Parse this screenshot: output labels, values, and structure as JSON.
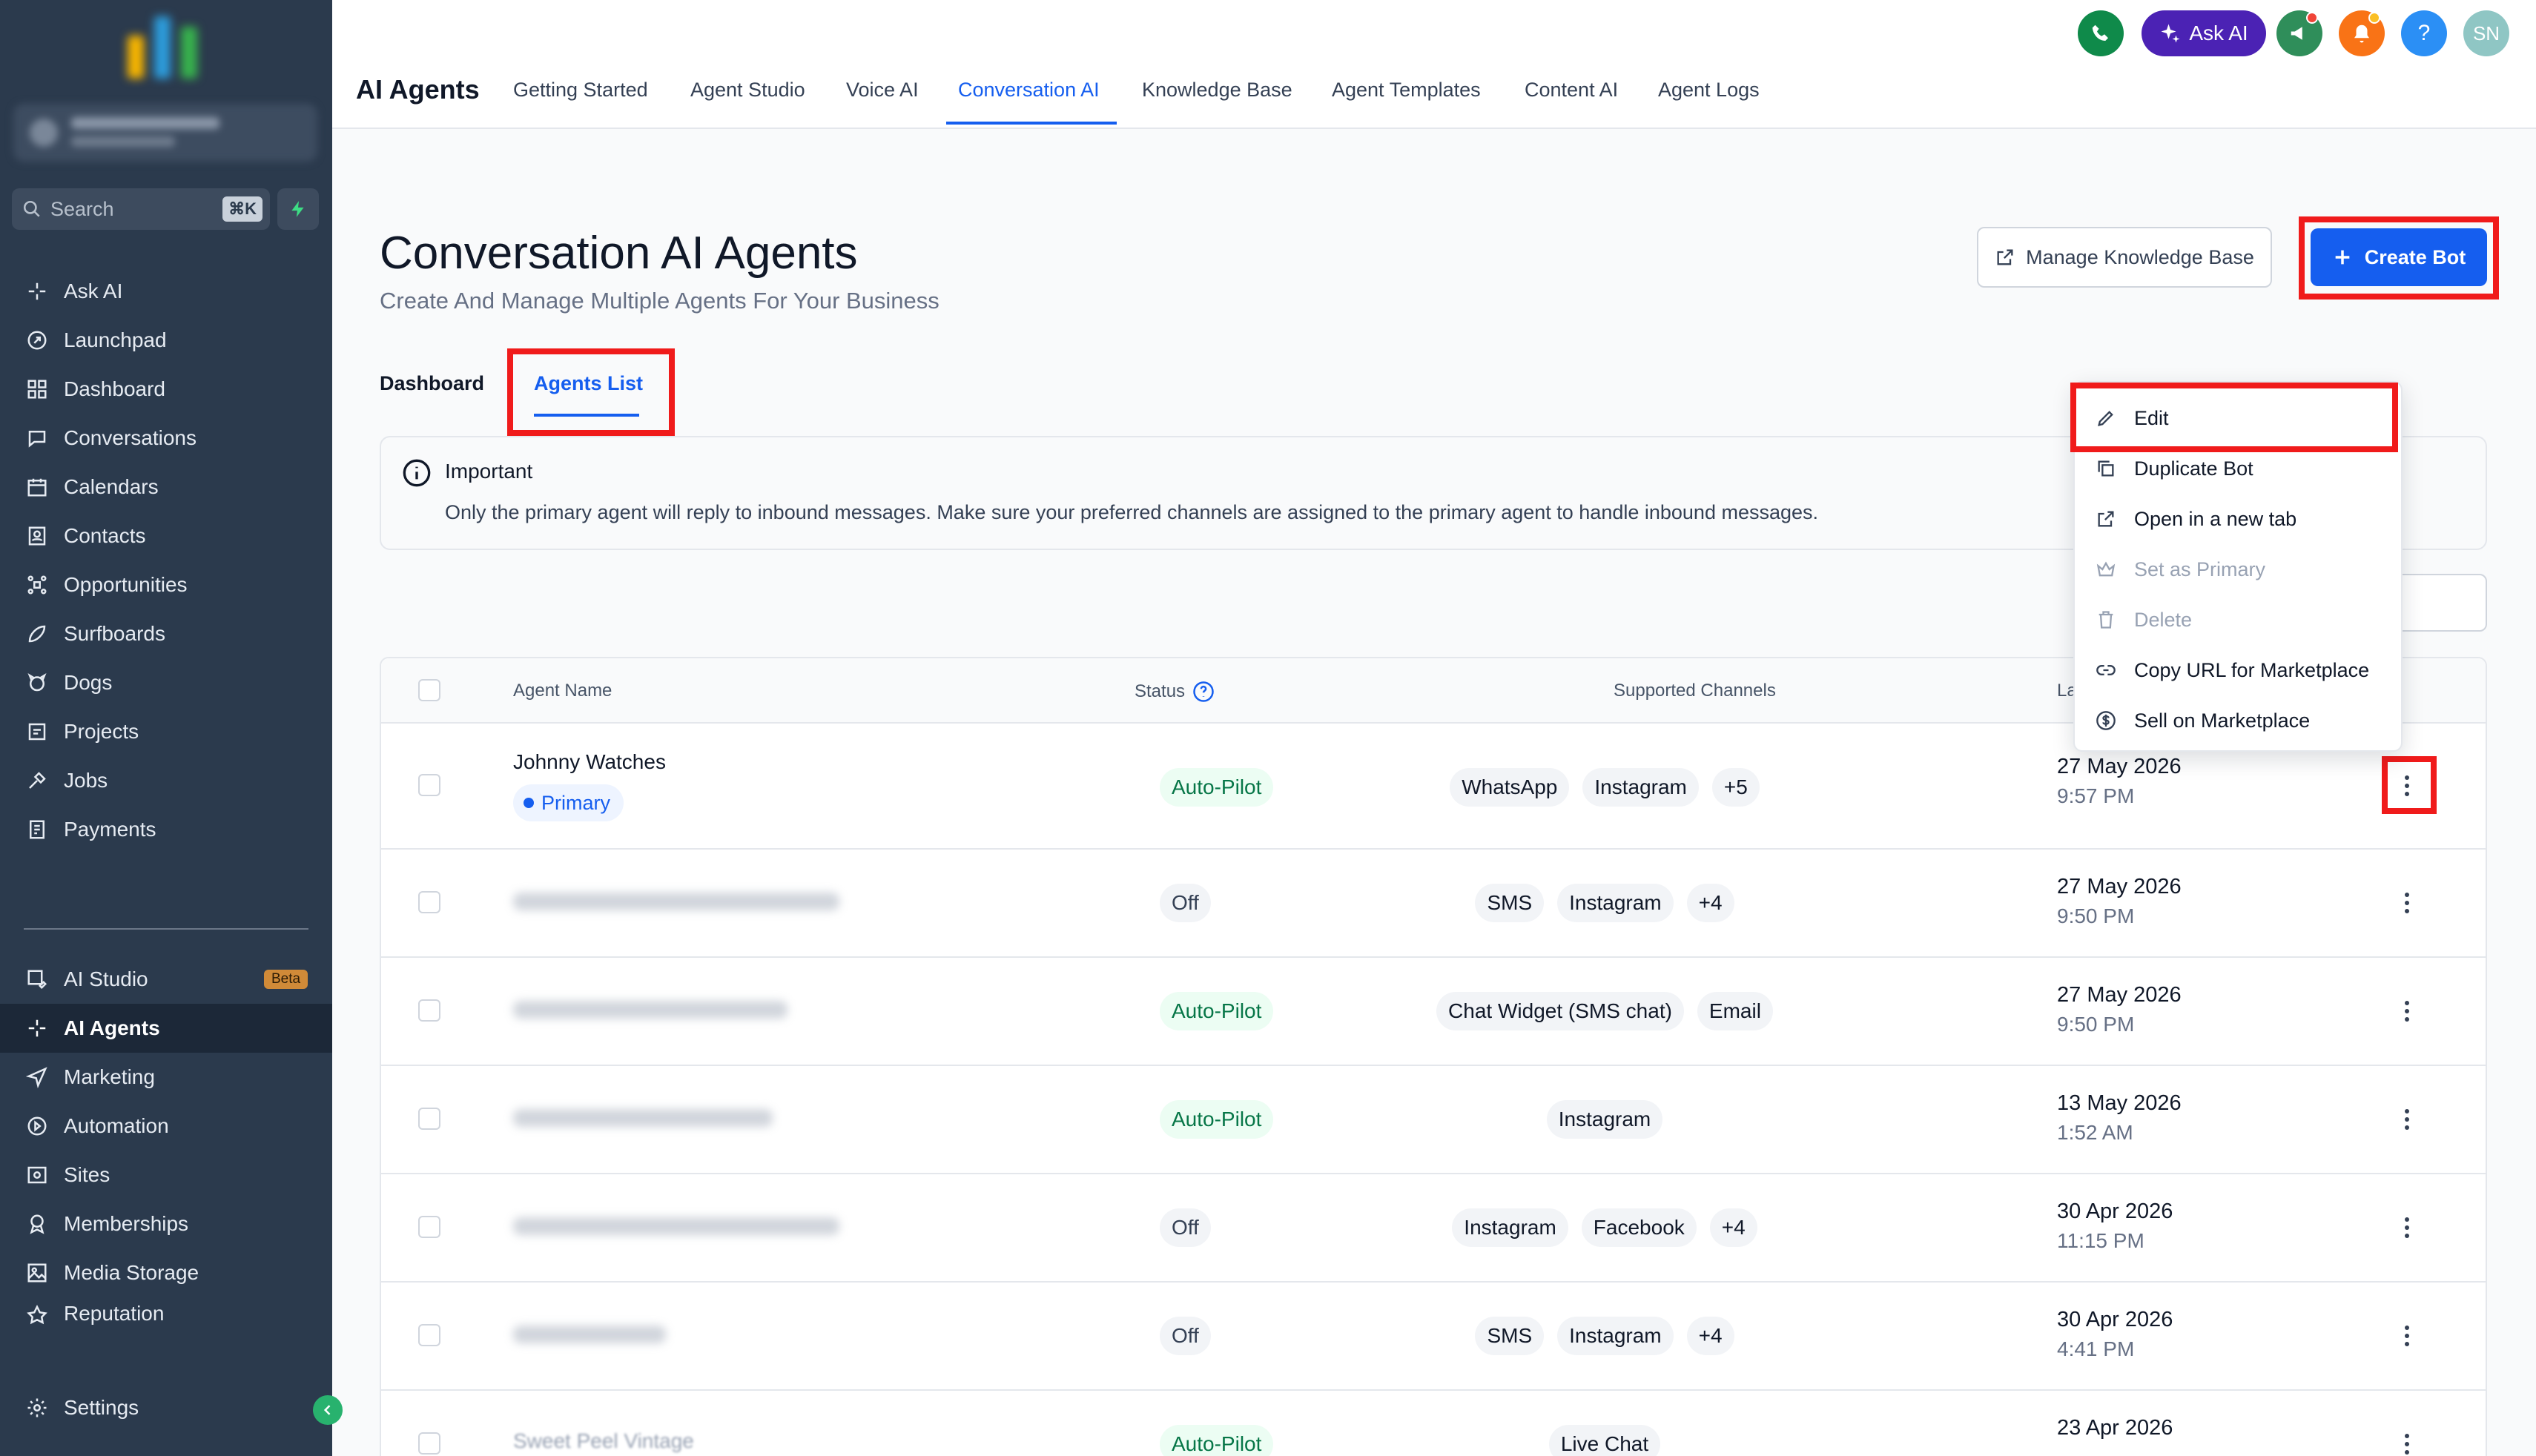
{
  "sidebar": {
    "search_placeholder": "Search",
    "search_shortcut": "⌘K",
    "items": [
      {
        "label": "Ask AI",
        "icon": "sparkle-icon"
      },
      {
        "label": "Launchpad",
        "icon": "rocket-icon"
      },
      {
        "label": "Dashboard",
        "icon": "grid-icon"
      },
      {
        "label": "Conversations",
        "icon": "chat-icon"
      },
      {
        "label": "Calendars",
        "icon": "calendar-icon"
      },
      {
        "label": "Contacts",
        "icon": "contacts-icon"
      },
      {
        "label": "Opportunities",
        "icon": "opportunities-icon"
      },
      {
        "label": "Surfboards",
        "icon": "surfboard-icon"
      },
      {
        "label": "Dogs",
        "icon": "dog-icon"
      },
      {
        "label": "Projects",
        "icon": "projects-icon"
      },
      {
        "label": "Jobs",
        "icon": "jobs-icon"
      },
      {
        "label": "Payments",
        "icon": "payments-icon"
      }
    ],
    "items2": [
      {
        "label": "AI Studio",
        "icon": "ai-studio-icon",
        "badge": "Beta"
      },
      {
        "label": "AI Agents",
        "icon": "sparkle-icon",
        "active": true
      },
      {
        "label": "Marketing",
        "icon": "send-icon"
      },
      {
        "label": "Automation",
        "icon": "automation-icon"
      },
      {
        "label": "Sites",
        "icon": "sites-icon"
      },
      {
        "label": "Memberships",
        "icon": "membership-icon"
      },
      {
        "label": "Media Storage",
        "icon": "media-icon"
      },
      {
        "label": "Reputation",
        "icon": "reputation-icon"
      }
    ],
    "settings_label": "Settings"
  },
  "topbar": {
    "title": "AI Agents",
    "tabs": [
      "Getting Started",
      "Agent Studio",
      "Voice AI",
      "Conversation AI",
      "Knowledge Base",
      "Agent Templates",
      "Content AI",
      "Agent Logs"
    ],
    "active_tab": "Conversation AI",
    "ask_ai_label": "Ask AI",
    "avatar_initials": "SN"
  },
  "page": {
    "title": "Conversation AI Agents",
    "subtitle": "Create And Manage Multiple Agents For Your Business",
    "manage_kb_label": "Manage Knowledge Base",
    "create_bot_label": "Create Bot",
    "tabs": [
      "Dashboard",
      "Agents List"
    ],
    "notice_title": "Important",
    "notice_message": "Only the primary agent will reply to inbound messages. Make sure your preferred channels are assigned to the primary agent to handle inbound messages."
  },
  "table": {
    "headers": {
      "name": "Agent Name",
      "status": "Status",
      "channels": "Supported Channels",
      "last": "La"
    },
    "rows": [
      {
        "name": "Johnny Watches",
        "primary_label": "Primary",
        "status": "Auto-Pilot",
        "channels": [
          "WhatsApp",
          "Instagram",
          "+5"
        ],
        "date": "27 May 2026",
        "time": "9:57 PM"
      },
      {
        "name": "",
        "status": "Off",
        "channels": [
          "SMS",
          "Instagram",
          "+4"
        ],
        "date": "27 May 2026",
        "time": "9:50 PM"
      },
      {
        "name": "",
        "status": "Auto-Pilot",
        "channels": [
          "Chat Widget (SMS chat)",
          "Email"
        ],
        "date": "27 May 2026",
        "time": "9:50 PM"
      },
      {
        "name": "",
        "status": "Auto-Pilot",
        "channels": [
          "Instagram"
        ],
        "date": "13 May 2026",
        "time": "1:52 AM"
      },
      {
        "name": "",
        "status": "Off",
        "channels": [
          "Instagram",
          "Facebook",
          "+4"
        ],
        "date": "30 Apr 2026",
        "time": "11:15 PM"
      },
      {
        "name": "",
        "status": "Off",
        "channels": [
          "SMS",
          "Instagram",
          "+4"
        ],
        "date": "30 Apr 2026",
        "time": "4:41 PM"
      },
      {
        "name": "Sweet Peel Vintage",
        "status": "Auto-Pilot",
        "channels": [
          "Live Chat"
        ],
        "date": "23 Apr 2026",
        "time": ""
      }
    ]
  },
  "menu": {
    "items": [
      {
        "label": "Edit",
        "icon": "pencil-icon",
        "disabled": false
      },
      {
        "label": "Duplicate Bot",
        "icon": "duplicate-icon",
        "disabled": false
      },
      {
        "label": "Open in a new tab",
        "icon": "external-link-icon",
        "disabled": false
      },
      {
        "label": "Set as Primary",
        "icon": "crown-icon",
        "disabled": true
      },
      {
        "label": "Delete",
        "icon": "trash-icon",
        "disabled": true
      },
      {
        "label": "Copy URL for Marketplace",
        "icon": "link-icon",
        "disabled": false
      },
      {
        "label": "Sell on Marketplace",
        "icon": "dollar-icon",
        "disabled": false
      }
    ]
  },
  "colors": {
    "accent": "#155eef",
    "sidebar": "#2b3a4d",
    "highlight": "#f01b1b",
    "success": "#067647"
  }
}
